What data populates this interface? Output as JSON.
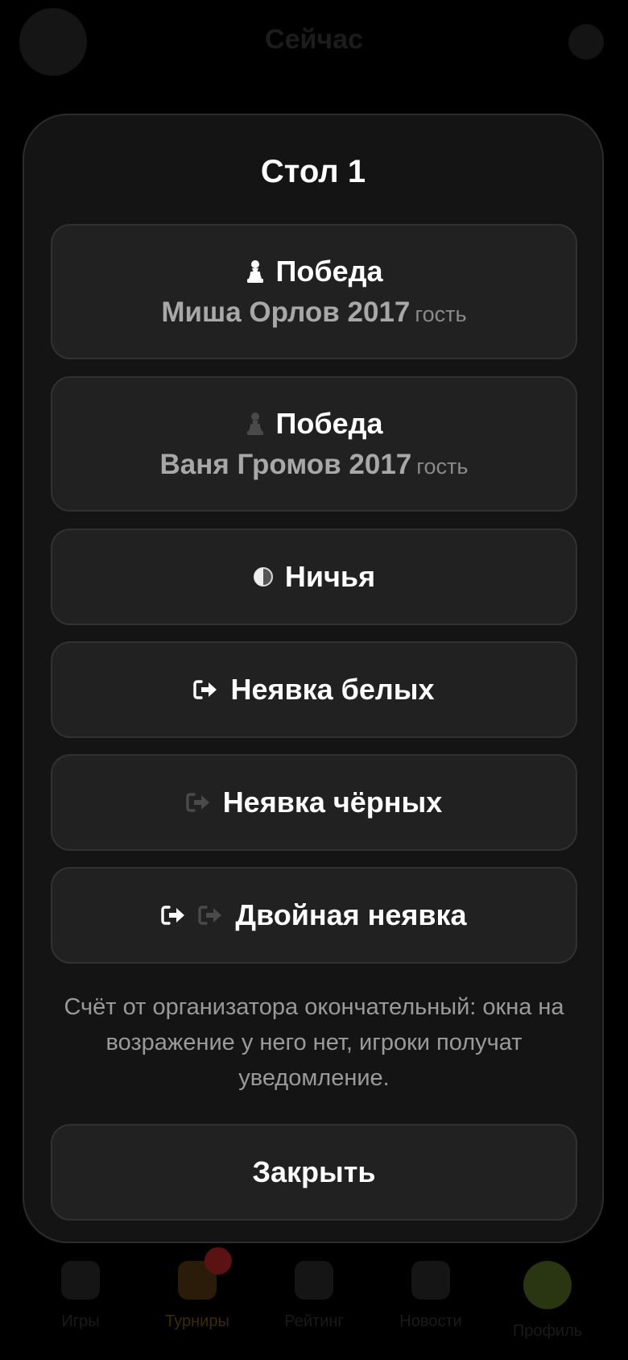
{
  "background": {
    "header_title": "Сейчас",
    "tabs": [
      {
        "label": "Игры"
      },
      {
        "label": "Турниры",
        "active": true
      },
      {
        "label": "Рейтинг"
      },
      {
        "label": "Новости"
      },
      {
        "label": "Профиль"
      }
    ]
  },
  "modal": {
    "title": "Стол 1",
    "options": [
      {
        "label": "Победа",
        "icon": "white-pawn-icon",
        "player": "Миша Орлов 2017",
        "tag": "гость"
      },
      {
        "label": "Победа",
        "icon": "black-pawn-icon",
        "player": "Ваня Громов 2017",
        "tag": "гость"
      },
      {
        "label": "Ничья",
        "icon": "half-circle-icon"
      },
      {
        "label": "Неявка белых",
        "icon": "exit-white-icon"
      },
      {
        "label": "Неявка чёрных",
        "icon": "exit-black-icon"
      },
      {
        "label": "Двойная неявка",
        "icon": "exit-both-icon"
      }
    ],
    "note": "Счёт от организатора окончательный: окна на возражение у него нет, игроки получат уведомление.",
    "close_label": "Закрыть"
  },
  "colors": {
    "modal_bg": "#141414",
    "option_bg": "#222121",
    "muted_text": "#9a9a9a",
    "accent_active_tab": "#3b2a08"
  }
}
